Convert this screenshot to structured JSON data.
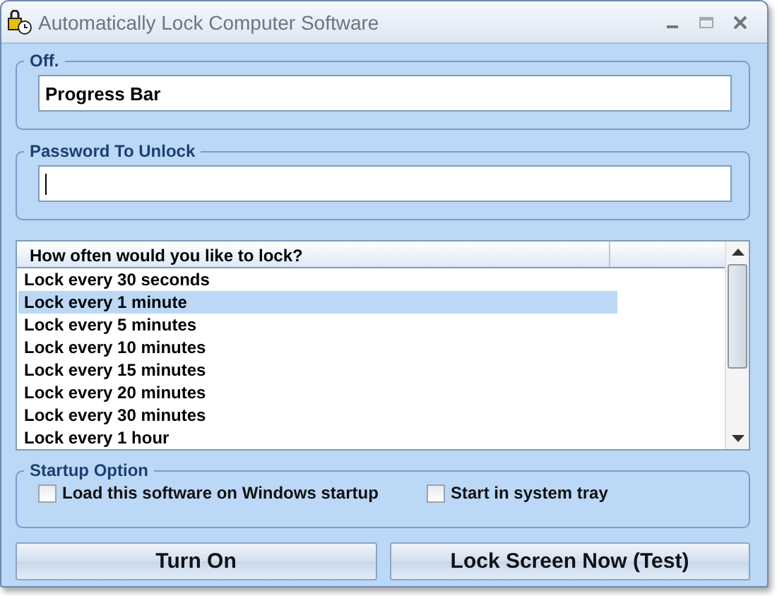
{
  "window": {
    "title": "Automatically Lock Computer Software"
  },
  "status_group": {
    "label": "Off.",
    "field_value": "Progress Bar"
  },
  "password_group": {
    "label": "Password To Unlock"
  },
  "list": {
    "column_header": "How often would you like to lock?",
    "items": [
      {
        "label": "Lock every 30 seconds",
        "selected": false
      },
      {
        "label": "Lock every 1 minute",
        "selected": true
      },
      {
        "label": "Lock every 5 minutes",
        "selected": false
      },
      {
        "label": "Lock every 10 minutes",
        "selected": false
      },
      {
        "label": "Lock every 15 minutes",
        "selected": false
      },
      {
        "label": "Lock every 20 minutes",
        "selected": false
      },
      {
        "label": "Lock every 30 minutes",
        "selected": false
      },
      {
        "label": "Lock every 1 hour",
        "selected": false
      }
    ]
  },
  "startup_group": {
    "label": "Startup Option",
    "options": [
      {
        "label": "Load this software on Windows startup",
        "checked": false
      },
      {
        "label": "Start in system tray",
        "checked": false
      }
    ]
  },
  "buttons": [
    "Turn On",
    "Lock Screen Now (Test)"
  ]
}
